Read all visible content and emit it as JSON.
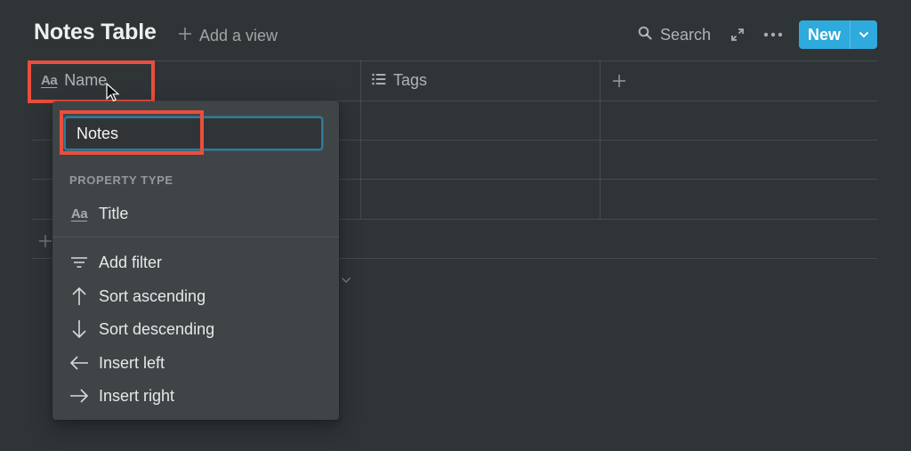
{
  "header": {
    "title": "Notes Table",
    "add_view_label": "Add a view",
    "search_label": "Search",
    "new_button_label": "New",
    "icons": {
      "add_view": "plus-icon",
      "search": "search-icon",
      "expand": "expand-icon",
      "more": "more-horizontal-icon",
      "new_caret": "chevron-down-icon"
    }
  },
  "colors": {
    "accent": "#2eaadc",
    "background": "#2f3437",
    "menu_background": "#3f4447",
    "highlight": "#ea4e3d"
  },
  "table": {
    "columns": [
      {
        "label": "Name",
        "icon": "text-aa-icon"
      },
      {
        "label": "Tags",
        "icon": "list-icon"
      }
    ],
    "add_column_icon": "plus-icon",
    "rows": [
      {
        "name": "",
        "tags": ""
      },
      {
        "name": "",
        "tags": ""
      },
      {
        "name": "",
        "tags": ""
      }
    ],
    "add_row_icon": "plus-icon",
    "calculate_icon": "chevron-down-icon"
  },
  "column_menu": {
    "rename_value": "Notes",
    "section_label": "PROPERTY TYPE",
    "property_type": {
      "label": "Title",
      "icon": "text-aa-icon"
    },
    "actions": [
      {
        "label": "Add filter",
        "icon": "filter-icon"
      },
      {
        "label": "Sort ascending",
        "icon": "arrow-up-icon"
      },
      {
        "label": "Sort descending",
        "icon": "arrow-down-icon"
      },
      {
        "label": "Insert left",
        "icon": "arrow-left-icon"
      },
      {
        "label": "Insert right",
        "icon": "arrow-right-icon"
      }
    ]
  }
}
